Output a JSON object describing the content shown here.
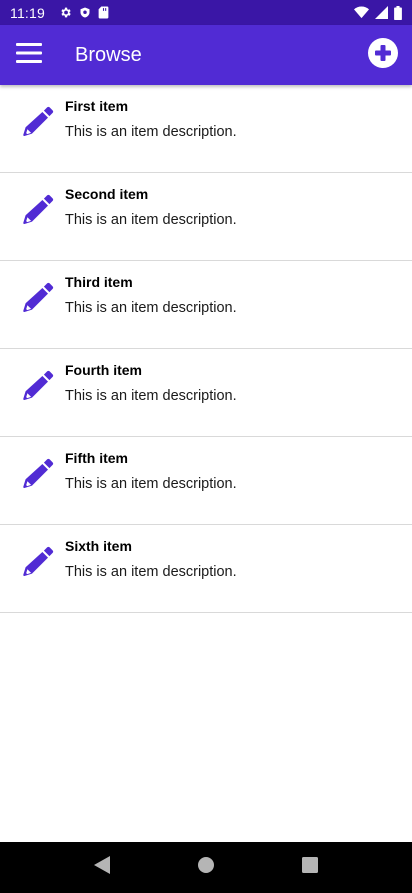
{
  "status_bar": {
    "time": "11:19",
    "icons_left": [
      "settings-icon",
      "shield-icon",
      "sd-card-icon"
    ],
    "icons_right": [
      "wifi-icon",
      "cell-signal-icon",
      "battery-icon"
    ]
  },
  "app_bar": {
    "title": "Browse",
    "menu_icon": "hamburger-menu-icon",
    "add_icon": "add-circle-icon"
  },
  "colors": {
    "status_bar": "#3a16a6",
    "app_bar": "#512bd4",
    "accent_icon": "#512bd4",
    "background": "#ffffff",
    "nav_bar": "#000000"
  },
  "items": [
    {
      "title": "First item",
      "description": "This is an item description.",
      "icon": "pencil-icon"
    },
    {
      "title": "Second item",
      "description": "This is an item description.",
      "icon": "pencil-icon"
    },
    {
      "title": "Third item",
      "description": "This is an item description.",
      "icon": "pencil-icon"
    },
    {
      "title": "Fourth item",
      "description": "This is an item description.",
      "icon": "pencil-icon"
    },
    {
      "title": "Fifth item",
      "description": "This is an item description.",
      "icon": "pencil-icon"
    },
    {
      "title": "Sixth item",
      "description": "This is an item description.",
      "icon": "pencil-icon"
    }
  ],
  "nav_bar": {
    "buttons": [
      "back-icon",
      "home-icon",
      "recents-icon"
    ]
  }
}
